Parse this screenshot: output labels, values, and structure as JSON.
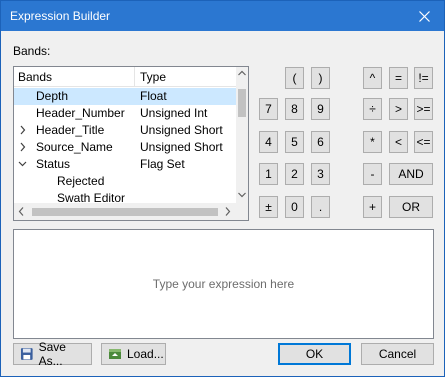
{
  "window": {
    "title": "Expression Builder"
  },
  "bands": {
    "label": "Bands:",
    "columns": {
      "bands": "Bands",
      "type": "Type"
    },
    "rows": [
      {
        "name": "Depth",
        "type": "Float",
        "expander": "none",
        "level": 0,
        "selected": true
      },
      {
        "name": "Header_Number",
        "type": "Unsigned Int",
        "expander": "none",
        "level": 0,
        "selected": false
      },
      {
        "name": "Header_Title",
        "type": "Unsigned Short",
        "expander": "collapsed",
        "level": 0,
        "selected": false
      },
      {
        "name": "Source_Name",
        "type": "Unsigned Short",
        "expander": "collapsed",
        "level": 0,
        "selected": false
      },
      {
        "name": "Status",
        "type": "Flag Set",
        "expander": "expanded",
        "level": 0,
        "selected": false
      },
      {
        "name": "Rejected",
        "type": "",
        "expander": "none",
        "level": 1,
        "selected": false
      },
      {
        "name": "Swath Editor",
        "type": "",
        "expander": "none",
        "level": 1,
        "selected": false
      }
    ]
  },
  "keypad": {
    "paren_open": "(",
    "paren_close": ")",
    "caret": "^",
    "equals": "=",
    "not_equals": "!=",
    "seven": "7",
    "eight": "8",
    "nine": "9",
    "divide": "÷",
    "greater": ">",
    "greater_equal": ">=",
    "four": "4",
    "five": "5",
    "six": "6",
    "multiply": "*",
    "less": "<",
    "less_equal": "<=",
    "one": "1",
    "two": "2",
    "three": "3",
    "minus": "-",
    "and": "AND",
    "plus_minus": "±",
    "zero": "0",
    "decimal": ".",
    "plus": "+",
    "or": "OR"
  },
  "expression": {
    "placeholder": "Type your expression here"
  },
  "footer": {
    "save_as": "Save As...",
    "load": "Load...",
    "ok": "OK",
    "cancel": "Cancel"
  },
  "colors": {
    "titlebar": "#2b77d1",
    "selection": "#cce8ff",
    "default_border": "#0078d7"
  },
  "icons": {
    "close": "close-icon",
    "save": "floppy-disk-icon",
    "load": "load-icon"
  }
}
